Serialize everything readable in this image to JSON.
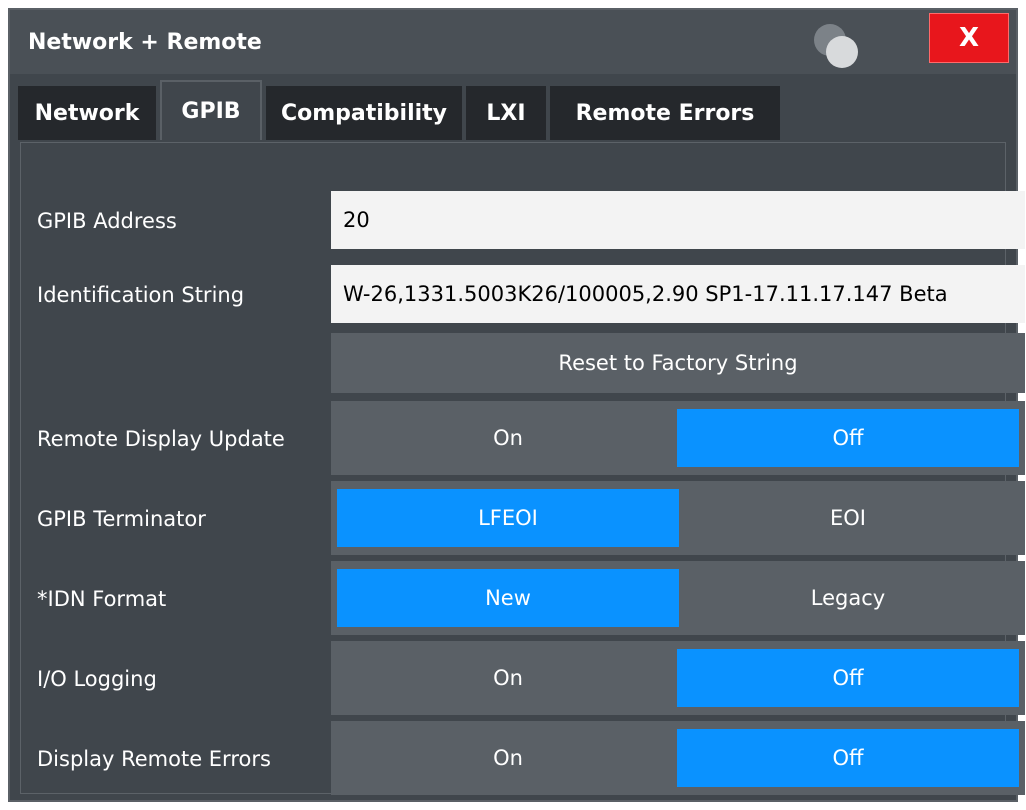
{
  "window": {
    "title": "Network + Remote",
    "close_label": "X"
  },
  "tabs": [
    "Network",
    "GPIB",
    "Compatibility",
    "LXI",
    "Remote Errors"
  ],
  "active_tab": "GPIB",
  "gpib": {
    "address": {
      "label": "GPIB Address",
      "value": "20"
    },
    "identification": {
      "label": "Identification String",
      "value": "W-26,1331.5003K26/100005,2.90 SP1-17.11.17.147 Beta"
    },
    "reset_button": "Reset to Factory String",
    "remote_display_update": {
      "label": "Remote Display Update",
      "options": [
        "On",
        "Off"
      ],
      "selected": "Off"
    },
    "terminator": {
      "label": "GPIB Terminator",
      "options": [
        "LFEOI",
        "EOI"
      ],
      "selected": "LFEOI"
    },
    "idn_format": {
      "label": "*IDN Format",
      "options": [
        "New",
        "Legacy"
      ],
      "selected": "New"
    },
    "io_logging": {
      "label": "I/O Logging",
      "options": [
        "On",
        "Off"
      ],
      "selected": "Off"
    },
    "display_remote_errors": {
      "label": "Display Remote Errors",
      "options": [
        "On",
        "Off"
      ],
      "selected": "Off"
    }
  },
  "colors": {
    "selected": "#0a92ff",
    "close": "#e8161c",
    "panel": "#40464c"
  }
}
